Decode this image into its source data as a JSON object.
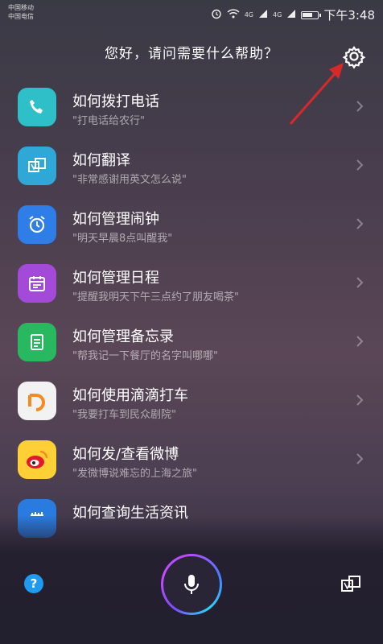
{
  "status_bar": {
    "carrier1": "中国移动",
    "carrier2": "中国电信",
    "net_label_1": "4G",
    "net_label_2": "4G",
    "time": "下午3:48"
  },
  "header": {
    "greeting": "您好，请问需要什么帮助？"
  },
  "colors": {
    "phone": "#2fbfc9",
    "translate": "#2fa8d8",
    "alarm": "#2f7de6",
    "calendar": "#a44ad8",
    "memo": "#28b85f",
    "didi": "#f2f2f2",
    "weibo": "#ffd035",
    "news": "#2a7be0",
    "arrow": "#d62a2a"
  },
  "items": [
    {
      "title": "如何拨打电话",
      "sub": "\"打电话给农行\"",
      "icon": "phone-icon"
    },
    {
      "title": "如何翻译",
      "sub": "\"非常感谢用英文怎么说\"",
      "icon": "translate-icon"
    },
    {
      "title": "如何管理闹钟",
      "sub": "\"明天早晨8点叫醒我\"",
      "icon": "alarm-clock-icon"
    },
    {
      "title": "如何管理日程",
      "sub": "\"提醒我明天下午三点约了朋友喝茶\"",
      "icon": "calendar-icon"
    },
    {
      "title": "如何管理备忘录",
      "sub": "\"帮我记一下餐厅的名字叫哪哪\"",
      "icon": "memo-icon"
    },
    {
      "title": "如何使用滴滴打车",
      "sub": "\"我要打车到民众剧院\"",
      "icon": "didi-icon"
    },
    {
      "title": "如何发/查看微博",
      "sub": "\"发微博说难忘的上海之旅\"",
      "icon": "weibo-icon"
    },
    {
      "title": "如何查询生活资讯",
      "sub": "",
      "icon": "news-icon"
    }
  ],
  "bottom": {
    "help_label": "?"
  }
}
